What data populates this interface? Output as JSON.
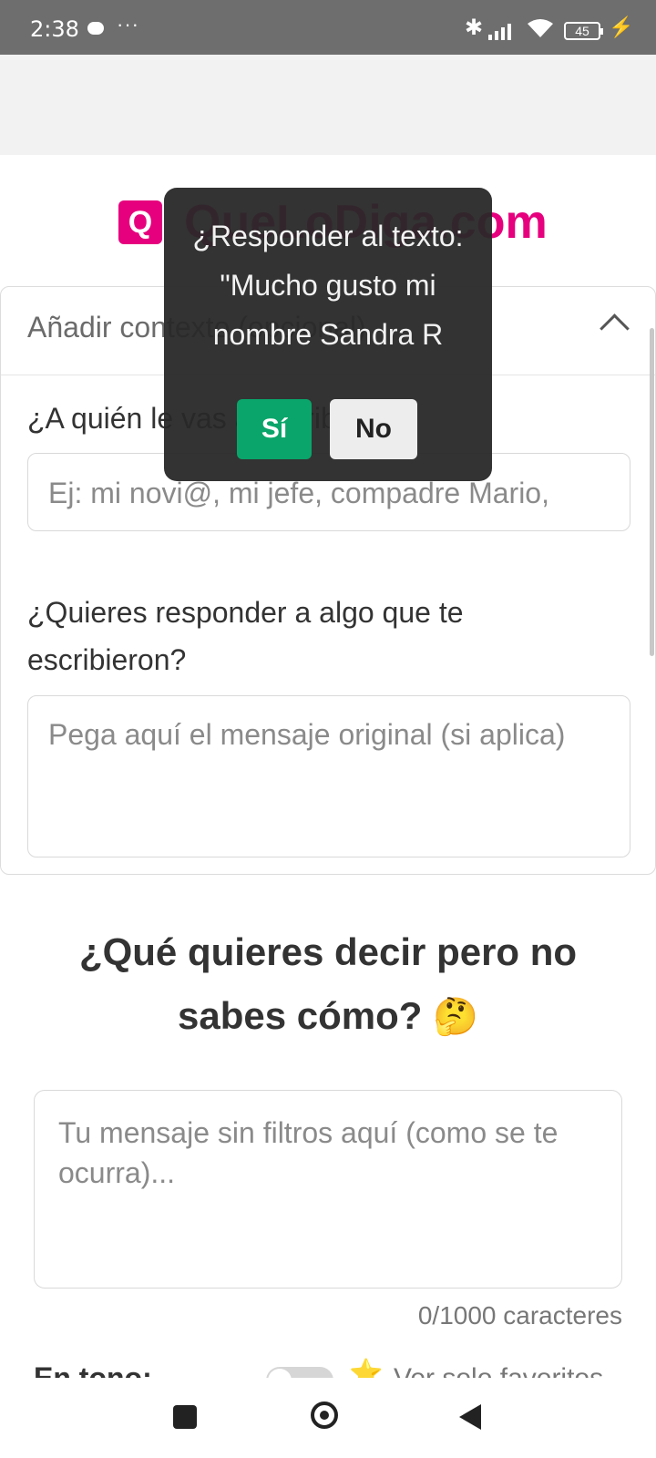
{
  "status_bar": {
    "time": "2:38",
    "more": "···",
    "battery": "45"
  },
  "logo": {
    "mark": "Q",
    "text": "QueLoDiga.com",
    "color": "#e6007e"
  },
  "context_card": {
    "title": "Añadir contexto (opcional)",
    "recipient_label": "¿A quién le vas a escribir?",
    "recipient_placeholder": "Ej: mi novi@, mi jefe, compadre Mario,",
    "reply_label": "¿Quieres responder a algo que te escribieron?",
    "reply_placeholder": "Pega aquí el mensaje original (si aplica)"
  },
  "main": {
    "title": "¿Qué quieres decir pero no sabes cómo?",
    "title_emoji": "🤔",
    "message_placeholder": "Tu mensaje sin filtros aquí (como se te ocurra)...",
    "counter": "0/1000 caracteres",
    "tone_label": "En tono:",
    "favorites_star": "⭐",
    "favorites_label": "Ver solo favoritos"
  },
  "dialog": {
    "text": "¿Responder al texto: \"Mucho gusto mi nombre Sandra R",
    "yes_label": "Sí",
    "no_label": "No",
    "yes_color": "#0aa56a"
  },
  "icons": [
    "chat-bubble-icon",
    "bluetooth-icon",
    "signal-icon",
    "wifi-icon",
    "battery-icon",
    "charging-icon",
    "chevron-up-icon",
    "recents-icon",
    "home-icon",
    "back-icon"
  ]
}
